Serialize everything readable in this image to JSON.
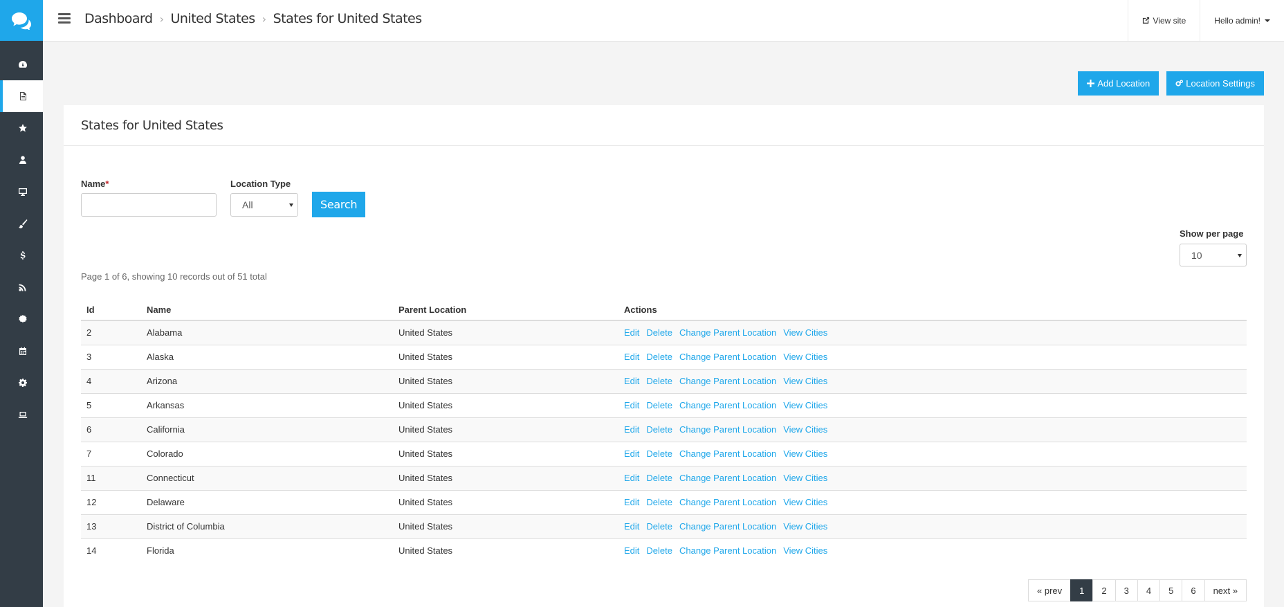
{
  "header": {
    "breadcrumb": [
      "Dashboard",
      "United States",
      "States for United States"
    ],
    "view_site": "View site",
    "user_menu": "Hello admin!"
  },
  "actions": {
    "add_location": "Add Location",
    "location_settings": "Location Settings"
  },
  "panel": {
    "title": "States for United States"
  },
  "filters": {
    "name_label": "Name",
    "required_mark": "*",
    "name_value": "",
    "type_label": "Location Type",
    "type_value": "All",
    "search_label": "Search",
    "per_page_label": "Show per page",
    "per_page_value": "10"
  },
  "records_info": "Page 1 of 6, showing 10 records out of 51 total",
  "table": {
    "headers": [
      "Id",
      "Name",
      "Parent Location",
      "Actions"
    ],
    "action_labels": [
      "Edit",
      "Delete",
      "Change Parent Location",
      "View Cities"
    ],
    "rows": [
      {
        "id": "2",
        "name": "Alabama",
        "parent": "United States"
      },
      {
        "id": "3",
        "name": "Alaska",
        "parent": "United States"
      },
      {
        "id": "4",
        "name": "Arizona",
        "parent": "United States"
      },
      {
        "id": "5",
        "name": "Arkansas",
        "parent": "United States"
      },
      {
        "id": "6",
        "name": "California",
        "parent": "United States"
      },
      {
        "id": "7",
        "name": "Colorado",
        "parent": "United States"
      },
      {
        "id": "11",
        "name": "Connecticut",
        "parent": "United States"
      },
      {
        "id": "12",
        "name": "Delaware",
        "parent": "United States"
      },
      {
        "id": "13",
        "name": "District of Columbia",
        "parent": "United States"
      },
      {
        "id": "14",
        "name": "Florida",
        "parent": "United States"
      }
    ]
  },
  "pagination": {
    "prev": "« prev",
    "pages": [
      "1",
      "2",
      "3",
      "4",
      "5",
      "6"
    ],
    "active": "1",
    "next": "next »"
  },
  "sidebar": {
    "icons": [
      "dashboard-icon",
      "document-icon",
      "star-icon",
      "user-icon",
      "desktop-icon",
      "brush-icon",
      "dollar-icon",
      "rss-icon",
      "badge-icon",
      "calendar-icon",
      "gear-icon",
      "laptop-icon"
    ],
    "active_index": 1
  },
  "colors": {
    "accent": "#1fa7ea",
    "sidebar": "#333d46"
  }
}
